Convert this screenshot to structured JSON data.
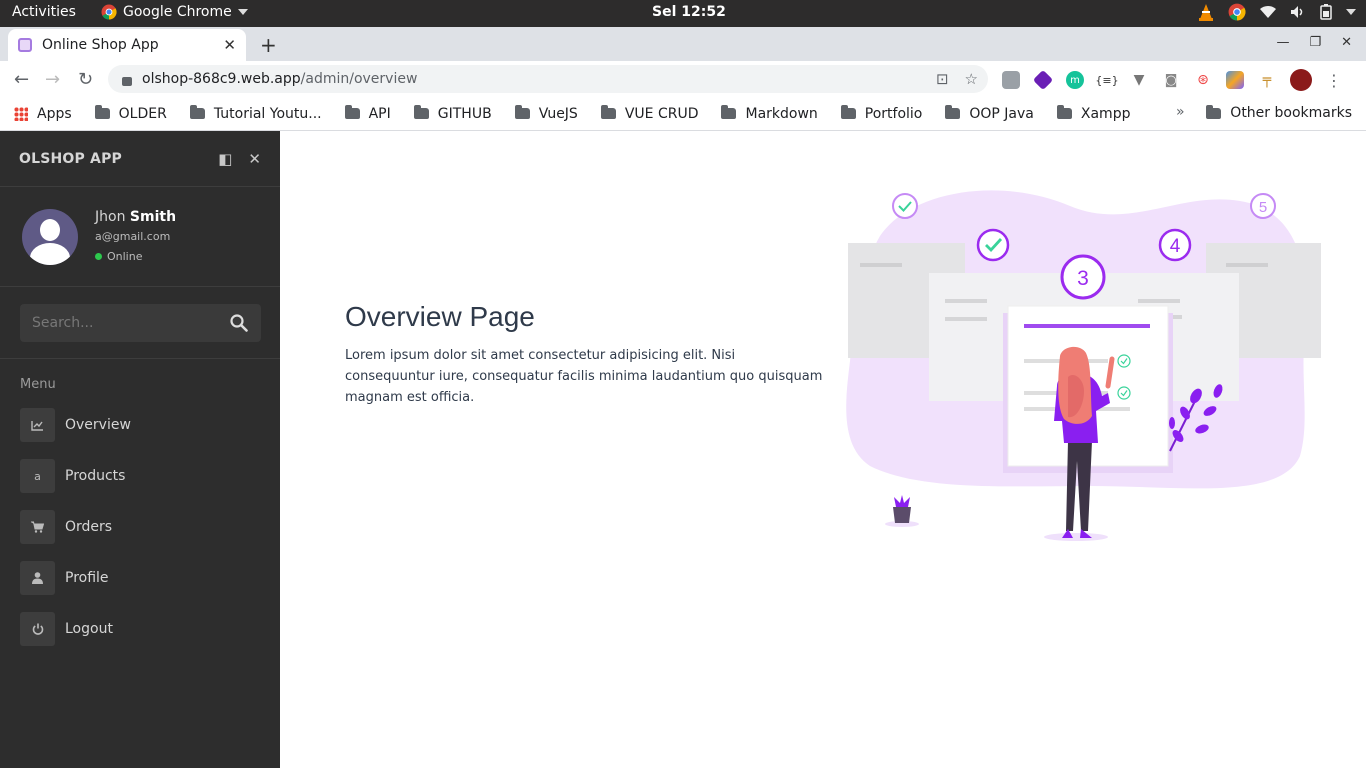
{
  "os": {
    "activities": "Activities",
    "app_menu": "Google Chrome",
    "clock": "Sel 12:52"
  },
  "browser": {
    "tab_title": "Online Shop App",
    "url_host": "olshop-868c9.web.app",
    "url_path": "/admin/overview",
    "bookmarks": [
      "Apps",
      "OLDER",
      "Tutorial Youtu...",
      "API",
      "GITHUB",
      "VueJS",
      "VUE CRUD",
      "Markdown",
      "Portfolio",
      "OOP Java",
      "Xampp"
    ],
    "overflow": "»",
    "other_bookmarks": "Other bookmarks"
  },
  "sidebar": {
    "brand": "OLSHOP APP",
    "user": {
      "first_name": "Jhon",
      "last_name": "Smith",
      "email": "a@gmail.com",
      "status": "Online"
    },
    "search_placeholder": "Search...",
    "menu_title": "Menu",
    "items": [
      {
        "label": "Overview",
        "icon": "chart-icon"
      },
      {
        "label": "Products",
        "icon": "amazon-icon"
      },
      {
        "label": "Orders",
        "icon": "cart-icon"
      },
      {
        "label": "Profile",
        "icon": "user-icon"
      },
      {
        "label": "Logout",
        "icon": "power-icon"
      }
    ]
  },
  "main": {
    "title": "Overview Page",
    "description": "Lorem ipsum dolor sit amet consectetur adipisicing elit. Nisi consequuntur iure, consequatur facilis minima laudantium quo quisquam magnam est officia.",
    "steps": [
      "3",
      "4",
      "5"
    ]
  },
  "colors": {
    "sidebar_bg": "#2d2d2d",
    "accent_purple": "#9b2bef",
    "online_green": "#2dc84d"
  }
}
